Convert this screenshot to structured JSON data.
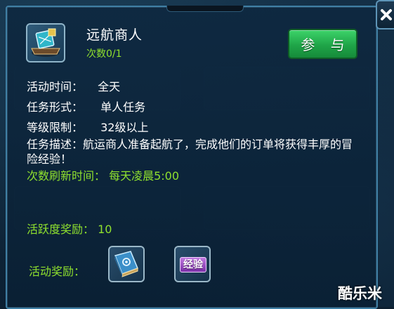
{
  "quest": {
    "title": "远航商人",
    "count_label": "次数0/1",
    "join_label": "参 与"
  },
  "details": {
    "time_label": "活动时间：",
    "time_value": "全天",
    "form_label": "任务形式：",
    "form_value": "单人任务",
    "level_label": "等级限制：",
    "level_value": "32级以上",
    "desc_label": "任务描述：",
    "desc_text": "航运商人准备起航了，完成他们的订单将获得丰厚的冒险经验！",
    "refresh_label": "次数刷新时间：",
    "refresh_value": "每天凌晨5:00"
  },
  "rewards": {
    "activity_label": "活跃度奖励：",
    "activity_value": "10",
    "reward_label": "活动奖励：",
    "exp_label": "经验"
  },
  "watermark": "酷乐米",
  "icons": {
    "quest_icon": "ship-cargo-icon",
    "book_icon": "spellbook-icon",
    "close_icon": "close-icon"
  }
}
